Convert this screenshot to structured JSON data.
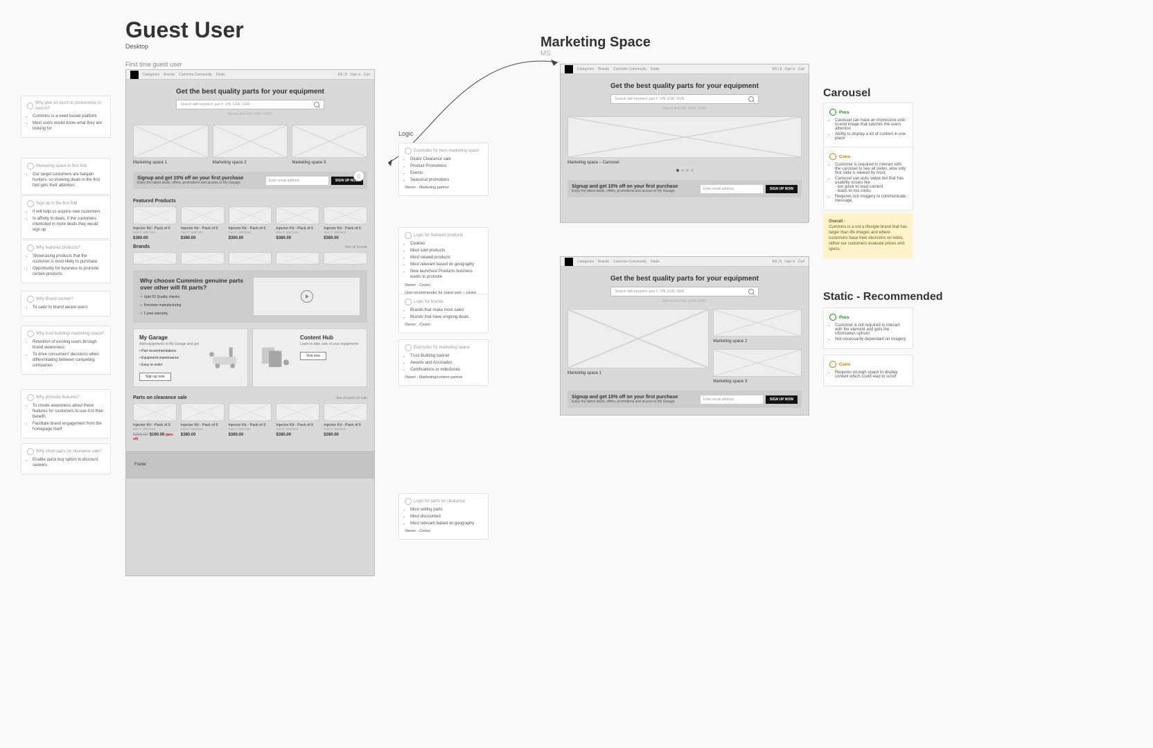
{
  "titles": {
    "main": "Guest User",
    "sub": "Desktop",
    "frame1": "First time guest user",
    "marketing": "Marketing Space",
    "mssub": "MS",
    "logic": "Logic",
    "carousel": "Carousel",
    "static": "Static - Recommended"
  },
  "hero": {
    "headline": "Get the best quality parts for your equipment",
    "placeholder": "Search with keyword, part #, VIN, ESN, GSN",
    "hint": "How to find VIN, ESN, GSN?"
  },
  "nav": {
    "items": [
      "Categories",
      "Brands",
      "Cummins Community",
      "Deals"
    ],
    "right": [
      "EN | $",
      "Sign in",
      "Cart"
    ]
  },
  "mspaces": {
    "m1": "Marketing space 1",
    "m2": "Marketing space 2",
    "m3": "Marketing space 3",
    "carousel": "Marketing space – Carousel"
  },
  "signup": {
    "title": "Signup and get 10% off on your first purchase",
    "sub": "Enjoy the latest deals, offers, promotions and access to My Garage",
    "placeholder": "Enter email address",
    "btn": "SIGN UP NOW"
  },
  "sections": {
    "featured": "Featured Products",
    "brands": "Brands",
    "clearance": "Parts on clearance sale",
    "seeAllBrands": "See all brands",
    "seeAllClearance": "See all parts on sale"
  },
  "product": {
    "name": "Injector Kit - Pack of 6",
    "id": "Part #: 2837646",
    "price": "$380.00",
    "was": "$399.99",
    "now": "$190.00",
    "off": "(50% off)"
  },
  "trust": {
    "title1": "Why choose Cummins genuine parts",
    "title2": "over other will fit parts?",
    "c1": "Upto 52 Quality checks",
    "c2": "Precision manufacturing",
    "c3": "2 year warranty"
  },
  "garage": {
    "title": "My Garage",
    "sub": "Add equipments to My Garage and get",
    "b1": "Part recommendations",
    "b2": "Equipment maintenance",
    "b3": "Easy re-order",
    "btn": "Sign up now"
  },
  "contenthub": {
    "title": "Content Hub",
    "sub": "Learn to take care of your equipments",
    "btn": "Visit now"
  },
  "footer": "Footer",
  "notes": {
    "n1": {
      "h": "Why give so much to prominence to search?",
      "b": [
        "Cummins is a need based platform",
        "Most users would know what they are looking for"
      ]
    },
    "n2": {
      "h": "Marketing space in first fold",
      "b": [
        "Our target customers are bargain hunters, so showing deals in the first fold gets their attention"
      ]
    },
    "n3": {
      "h": "Sign up in the first fold",
      "b": [
        "It will help us acquire new customers",
        "In affinity to deals, if the customers interested in more deals they would sign up"
      ]
    },
    "n4": {
      "h": "Why featured products?",
      "b": [
        "Showcasing products that the customer is most likely to purchase",
        "Opportunity for business to promote certain products"
      ]
    },
    "n5": {
      "h": "Why Brand section?",
      "b": [
        "To cater to brand aware users"
      ]
    },
    "n6": {
      "h": "Why trust building/ marketing space?",
      "b": [
        "Retention of existing users through brand awareness",
        "To drive consumers' decisions when differentiating between competing companies"
      ]
    },
    "n7": {
      "h": "Why promote features?",
      "b": [
        "To create awareness about these features for customers to use it to their benefit.",
        "Facilitate brand engagement from the homepage itself"
      ]
    },
    "n8": {
      "h": "Why show parts on clearance sale?",
      "b": [
        "Enable quick buy option to discount seekers"
      ]
    },
    "r1": {
      "h": "Examples for hero marketing space",
      "b": [
        "Deals/ Clearance sale",
        "Product Promotions",
        "Events",
        "Seasonal promotions"
      ],
      "owner": "Owner - Marketing partner"
    },
    "r2": {
      "h": "Logic for featured products",
      "b": [
        "Cookies",
        "Most sold products",
        "Most viewed products",
        "Most relevant based on geography",
        "New launches/ Products business wants to promote"
      ],
      "owner": "Owner - Coveo",
      "extra": "User recommender for guest user – coveo model"
    },
    "r3": {
      "h": "Logic for brands",
      "b": [
        "Brands that make most sales",
        "Brands that have ongoing deals"
      ],
      "owner": "Owner - Coveo"
    },
    "r4": {
      "h": "Examples for marketing space",
      "b": [
        "Trust Building banner",
        "Awards and Accolades",
        "Certifications or milestones"
      ],
      "owner": "Owner - Marketing/content partner"
    },
    "r5": {
      "h": "Logic for parts on clearance",
      "b": [
        "Most selling parts",
        "Most discounted",
        "Most relevant based on geography"
      ],
      "owner": "Owner - Coveo"
    }
  },
  "carousel": {
    "pros": [
      "Carousel can have an impressive end-to-end image that catches the users attention",
      "Ability to display a lot of content in one place"
    ],
    "cons": [
      "Customer is required to interact with the carousel to see all slides, else only first slide is viewed by most.",
      "Carousel can auto-swipe but that has usability issues like\n- too quick to read content\n- leads to mis clicks",
      "Requires rich imagery to communicate message."
    ],
    "overallTitle": "Overall -",
    "overall": "Cummins is a not a lifestyle brand that has larger than life images and where customers base their decisions on looks, rather our customers evaluate prices and specs."
  },
  "static": {
    "pros": [
      "Customer is not required to interact with the element and gets the information upfront",
      "Not necessarily dependant on imagery"
    ],
    "cons": [
      "Requires enough space to display content which could lead to scroll"
    ]
  },
  "labels": {
    "pros": "Pros",
    "cons": "Cons"
  }
}
